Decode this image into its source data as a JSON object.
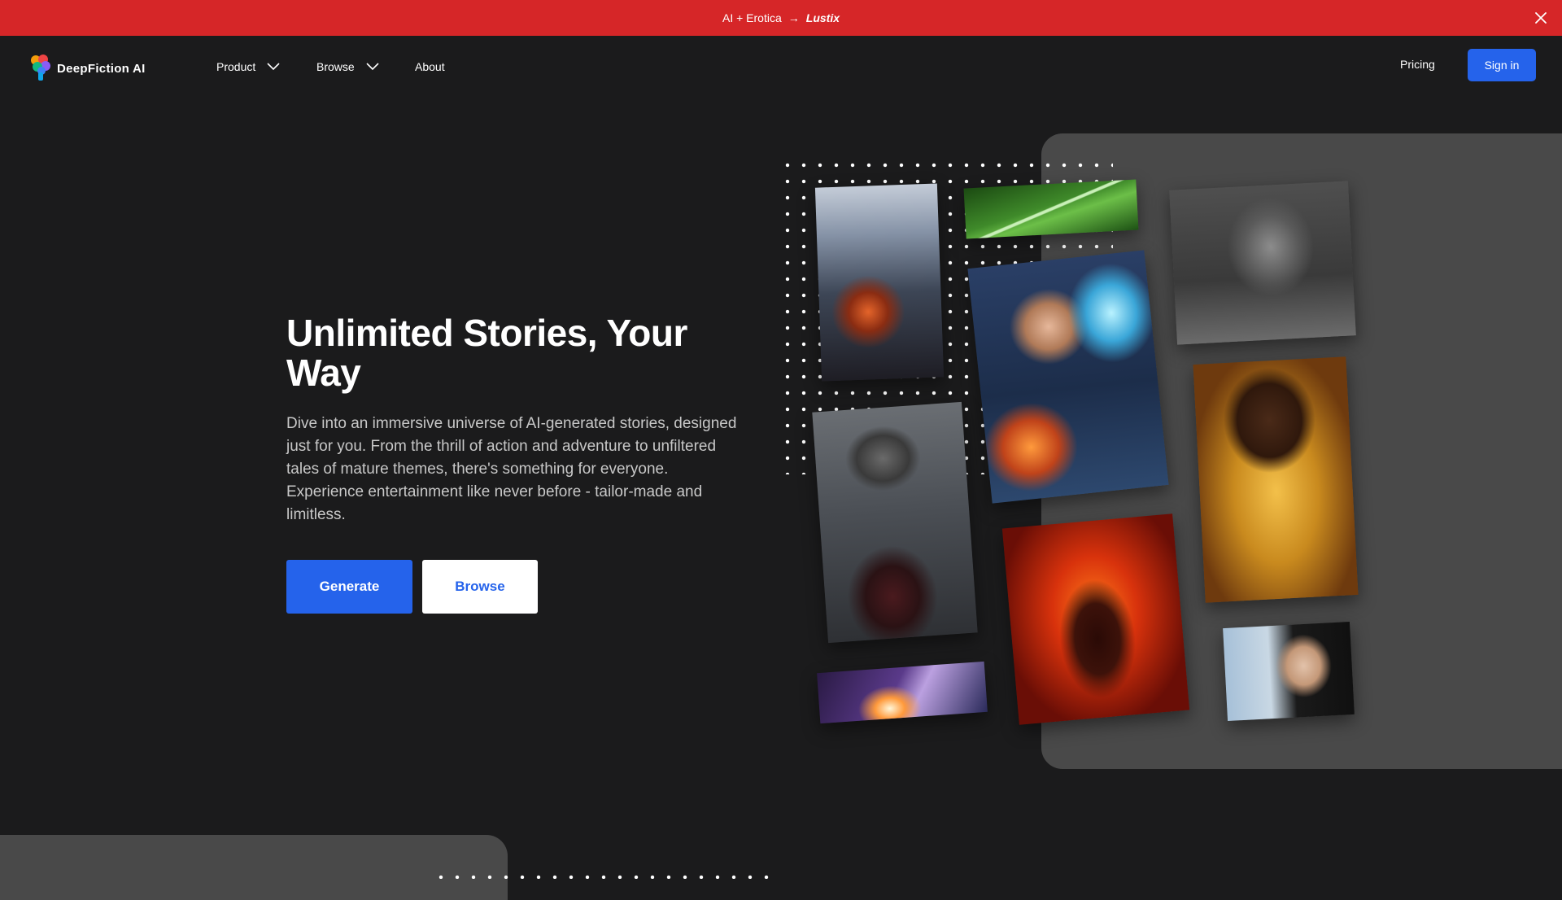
{
  "banner": {
    "text": "AI + Erotica",
    "arrow": "→",
    "brand": "Lustix",
    "close_icon": "close-icon"
  },
  "nav": {
    "logo_text": "DeepFiction AI",
    "items": [
      {
        "label": "Product",
        "icon": "chevron-down-icon"
      },
      {
        "label": "Browse",
        "icon": "chevron-down-icon"
      },
      {
        "label": "About"
      }
    ],
    "pricing": "Pricing",
    "signin": "Sign in"
  },
  "hero": {
    "title": "Unlimited Stories, Your Way",
    "description": "Dive into an immersive universe of AI-generated stories, designed just for you. From the thrill of action and adventure to unfiltered tales of mature themes, there's something for everyone. Experience entertainment like never before - tailor-made and limitless.",
    "generate_label": "Generate",
    "browse_label": "Browse"
  },
  "colors": {
    "banner": "#d62628",
    "accent": "#2563eb",
    "background": "#1b1b1c",
    "panel": "#494949"
  }
}
